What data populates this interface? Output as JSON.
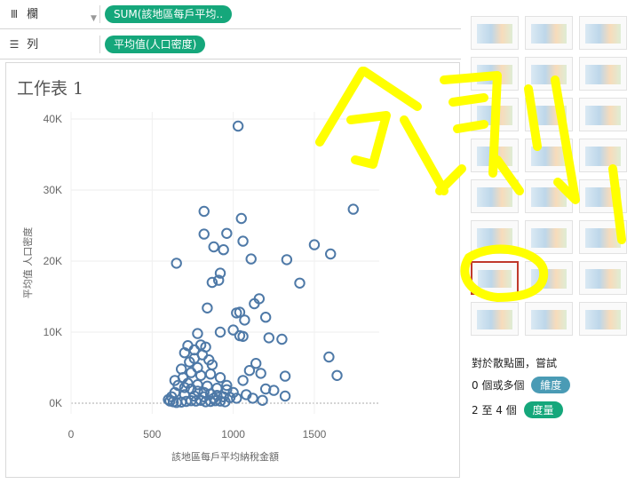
{
  "shelves": {
    "columns": {
      "label": "欄",
      "pill": "SUM(該地區每戶平均.."
    },
    "rows": {
      "label": "列",
      "pill": "平均值(人口密度)"
    }
  },
  "sheet": {
    "title": "工作表 1"
  },
  "chart_data": {
    "type": "scatter",
    "xlabel": "該地區每戶平均納稅金額",
    "ylabel": "平均值 人口密度",
    "xlim": [
      0,
      1900
    ],
    "ylim": [
      -1500,
      41000
    ],
    "xticks": [
      0,
      500,
      1000,
      1500
    ],
    "xtick_labels": [
      "0",
      "500",
      "1000",
      "1500"
    ],
    "yticks": [
      0,
      10000,
      20000,
      30000,
      40000
    ],
    "ytick_labels": [
      "0K",
      "10K",
      "20K",
      "30K",
      "40K"
    ],
    "grid": true,
    "marker": "open-circle",
    "color": "#4e79a7",
    "points": [
      [
        1030,
        39000
      ],
      [
        820,
        27000
      ],
      [
        1740,
        27300
      ],
      [
        1050,
        26000
      ],
      [
        820,
        23800
      ],
      [
        960,
        23900
      ],
      [
        1500,
        22300
      ],
      [
        1600,
        21000
      ],
      [
        1330,
        20200
      ],
      [
        650,
        19700
      ],
      [
        1060,
        22800
      ],
      [
        880,
        22000
      ],
      [
        940,
        21600
      ],
      [
        1110,
        20300
      ],
      [
        920,
        18300
      ],
      [
        910,
        17300
      ],
      [
        870,
        17000
      ],
      [
        1410,
        16900
      ],
      [
        1160,
        14700
      ],
      [
        1130,
        14000
      ],
      [
        840,
        13400
      ],
      [
        1040,
        12800
      ],
      [
        1020,
        12700
      ],
      [
        1200,
        12100
      ],
      [
        1070,
        11700
      ],
      [
        1000,
        10300
      ],
      [
        920,
        10000
      ],
      [
        1040,
        9500
      ],
      [
        1060,
        9400
      ],
      [
        1220,
        9200
      ],
      [
        1300,
        9000
      ],
      [
        780,
        9800
      ],
      [
        720,
        8100
      ],
      [
        800,
        8200
      ],
      [
        830,
        7900
      ],
      [
        760,
        7500
      ],
      [
        700,
        7100
      ],
      [
        1590,
        6500
      ],
      [
        1640,
        3900
      ],
      [
        1320,
        3800
      ],
      [
        1140,
        5600
      ],
      [
        1100,
        4600
      ],
      [
        1170,
        4200
      ],
      [
        870,
        5400
      ],
      [
        780,
        5000
      ],
      [
        740,
        4300
      ],
      [
        860,
        4100
      ],
      [
        800,
        3900
      ],
      [
        920,
        3600
      ],
      [
        1060,
        3200
      ],
      [
        1200,
        2000
      ],
      [
        1250,
        1800
      ],
      [
        1320,
        1000
      ],
      [
        690,
        3600
      ],
      [
        640,
        3200
      ],
      [
        660,
        2500
      ],
      [
        700,
        2200
      ],
      [
        740,
        2000
      ],
      [
        780,
        1700
      ],
      [
        820,
        1500
      ],
      [
        860,
        1300
      ],
      [
        900,
        1100
      ],
      [
        940,
        900
      ],
      [
        980,
        800
      ],
      [
        1020,
        700
      ],
      [
        620,
        900
      ],
      [
        600,
        500
      ],
      [
        610,
        300
      ],
      [
        630,
        200
      ],
      [
        650,
        100
      ],
      [
        680,
        150
      ],
      [
        710,
        250
      ],
      [
        740,
        350
      ],
      [
        770,
        300
      ],
      [
        800,
        400
      ],
      [
        830,
        200
      ],
      [
        860,
        250
      ],
      [
        890,
        350
      ],
      [
        920,
        300
      ],
      [
        950,
        200
      ],
      [
        640,
        1500
      ],
      [
        700,
        1200
      ],
      [
        760,
        1000
      ],
      [
        820,
        900
      ],
      [
        880,
        700
      ],
      [
        720,
        2800
      ],
      [
        780,
        2600
      ],
      [
        840,
        2400
      ],
      [
        900,
        2100
      ],
      [
        960,
        1900
      ],
      [
        680,
        4800
      ],
      [
        730,
        5800
      ],
      [
        760,
        6300
      ],
      [
        810,
        6800
      ],
      [
        850,
        6100
      ],
      [
        960,
        2500
      ],
      [
        1000,
        1500
      ],
      [
        1080,
        1200
      ],
      [
        1120,
        700
      ],
      [
        1180,
        400
      ]
    ]
  },
  "showme": {
    "charts": [
      {
        "name": "text-table-thumb"
      },
      {
        "name": "heat-map-thumb"
      },
      {
        "name": "highlight-table-thumb"
      },
      {
        "name": "symbol-map-thumb"
      },
      {
        "name": "filled-map-thumb"
      },
      {
        "name": "pie-chart-thumb"
      },
      {
        "name": "horizontal-bars-thumb"
      },
      {
        "name": "stacked-bars-thumb"
      },
      {
        "name": "side-by-side-bars-thumb"
      },
      {
        "name": "treemap-thumb"
      },
      {
        "name": "circle-views-thumb"
      },
      {
        "name": "side-by-side-circles-thumb"
      },
      {
        "name": "lines-continuous-thumb"
      },
      {
        "name": "lines-discrete-thumb"
      },
      {
        "name": "dual-lines-thumb"
      },
      {
        "name": "area-continuous-thumb"
      },
      {
        "name": "area-discrete-thumb"
      },
      {
        "name": "dual-combination-thumb"
      },
      {
        "name": "scatter-plot-thumb"
      },
      {
        "name": "histogram-thumb"
      },
      {
        "name": "box-plot-thumb"
      },
      {
        "name": "gantt-chart-thumb"
      },
      {
        "name": "bullet-graph-thumb"
      },
      {
        "name": "packed-bubbles-thumb"
      }
    ],
    "selected_index": 18,
    "hint_line1": "對於散點圖，嘗試",
    "hint_line2_prefix": "0 個或多個",
    "hint_line2_tag": "維度",
    "hint_line3_prefix": "2 至 4 個",
    "hint_line3_tag": "度量",
    "tag_dimension_color": "#4a9bb5",
    "tag_measure_color": "#15a77b"
  },
  "overlay": {
    "color": "#ffff00"
  }
}
